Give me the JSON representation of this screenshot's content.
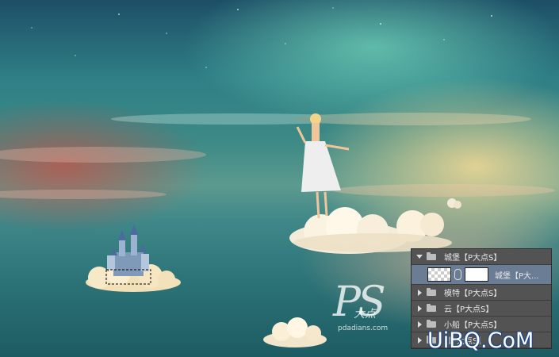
{
  "watermark": {
    "big": "PS",
    "cn": "大点",
    "site": "pdadians.com"
  },
  "layers_panel": {
    "rows": [
      {
        "label": "城堡【P大点S】",
        "kind": "group-expanded"
      },
      {
        "label": "城堡【P大...",
        "kind": "layer-selected"
      },
      {
        "label": "模特【P大点S】",
        "kind": "group"
      },
      {
        "label": "云【P大点S】",
        "kind": "group"
      },
      {
        "label": "小船【P大点S】",
        "kind": "group"
      },
      {
        "label": "【P大点S】",
        "kind": "group"
      }
    ]
  },
  "site_watermark": "UiBQ.CoM",
  "icons": [
    "triangle-down-icon",
    "folder-icon",
    "chain-link-icon",
    "triangle-right-icon"
  ],
  "colors": {
    "panel_bg": "#535353",
    "selected_row": "#6a7d95",
    "sky_top": "#1d4f66"
  }
}
